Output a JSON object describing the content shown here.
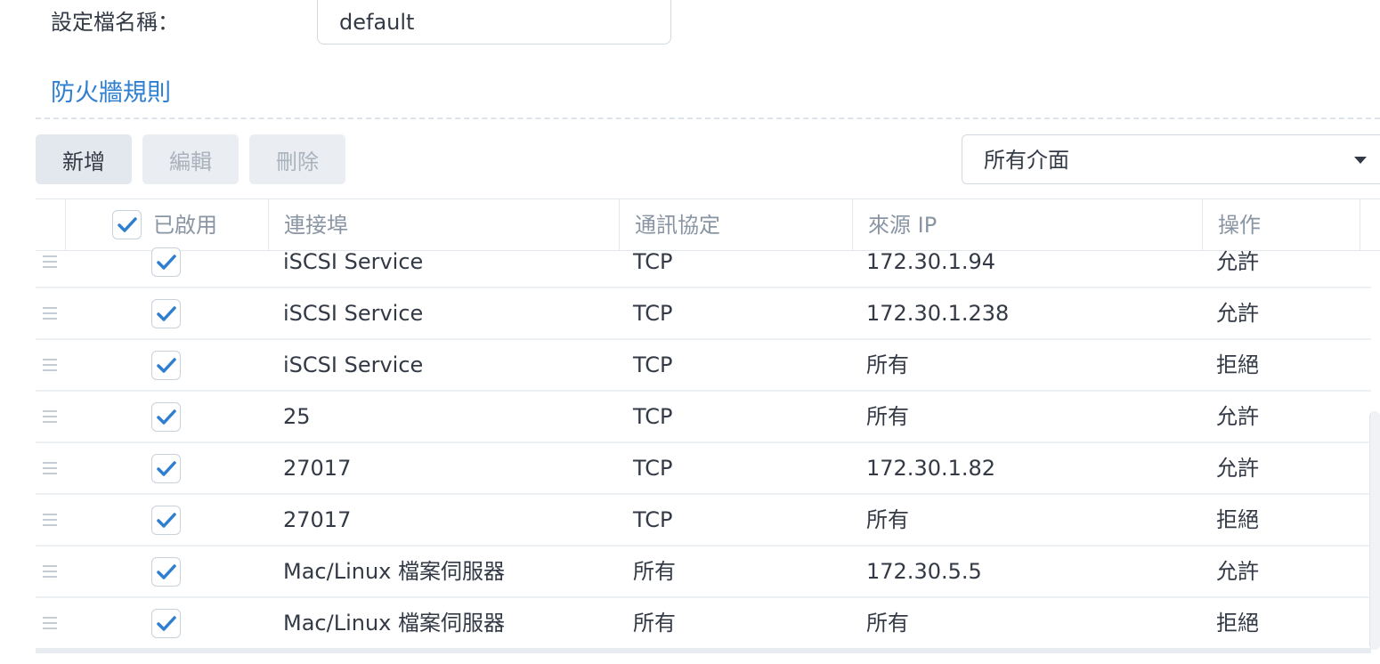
{
  "profile": {
    "label": "設定檔名稱：",
    "value": "default"
  },
  "section_title": "防火牆規則",
  "toolbar": {
    "add_label": "新增",
    "edit_label": "編輯",
    "delete_label": "刪除"
  },
  "interface_select": {
    "selected": "所有介面"
  },
  "table": {
    "columns": {
      "enabled": "已啟用",
      "port": "連接埠",
      "protocol": "通訊協定",
      "source_ip": "來源 IP",
      "action": "操作"
    },
    "header_checked": true,
    "rows": [
      {
        "enabled": true,
        "port": "iSCSI Service",
        "protocol": "TCP",
        "source_ip": "172.30.1.94",
        "action": "允許"
      },
      {
        "enabled": true,
        "port": "iSCSI Service",
        "protocol": "TCP",
        "source_ip": "172.30.1.238",
        "action": "允許"
      },
      {
        "enabled": true,
        "port": "iSCSI Service",
        "protocol": "TCP",
        "source_ip": "所有",
        "action": "拒絕"
      },
      {
        "enabled": true,
        "port": "25",
        "protocol": "TCP",
        "source_ip": "所有",
        "action": "允許"
      },
      {
        "enabled": true,
        "port": "27017",
        "protocol": "TCP",
        "source_ip": "172.30.1.82",
        "action": "允許"
      },
      {
        "enabled": true,
        "port": "27017",
        "protocol": "TCP",
        "source_ip": "所有",
        "action": "拒絕"
      },
      {
        "enabled": true,
        "port": "Mac/Linux 檔案伺服器",
        "protocol": "所有",
        "source_ip": "172.30.5.5",
        "action": "允許"
      },
      {
        "enabled": true,
        "port": "Mac/Linux 檔案伺服器",
        "protocol": "所有",
        "source_ip": "所有",
        "action": "拒絕"
      }
    ]
  },
  "colors": {
    "accent": "#2f7fd0",
    "check": "#2f7fd0"
  }
}
